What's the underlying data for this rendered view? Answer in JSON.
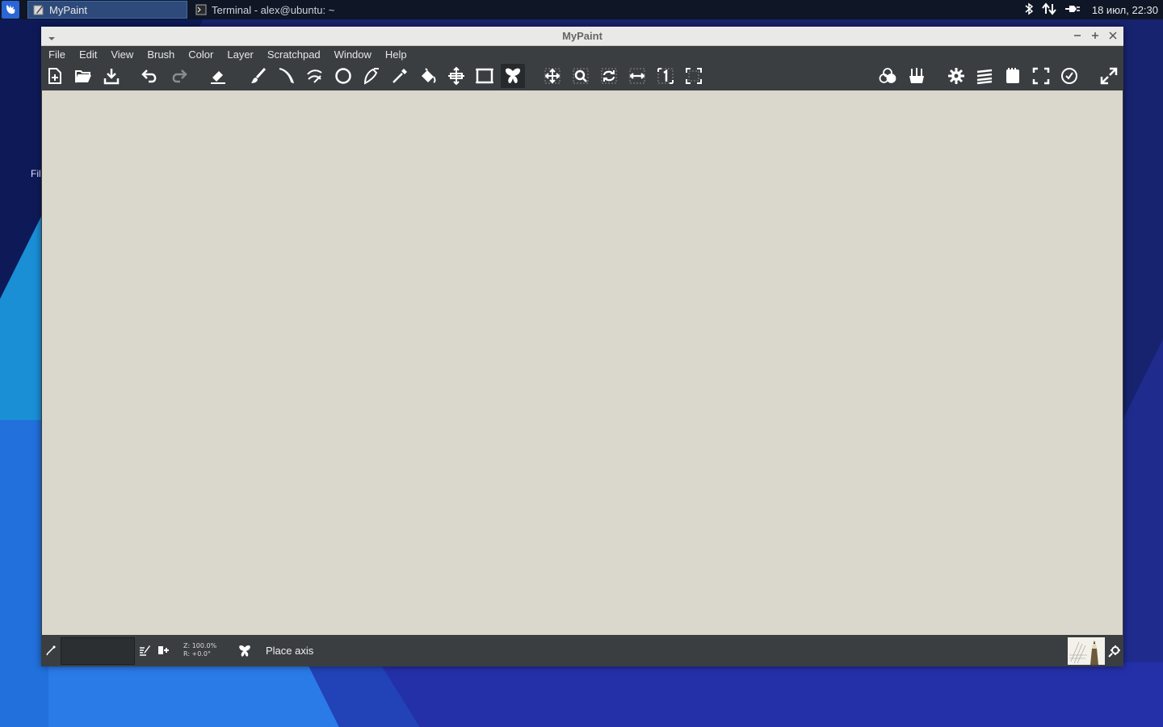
{
  "panel": {
    "tasks": [
      {
        "label": "MyPaint",
        "icon": "mypaint-app-icon",
        "active": true
      },
      {
        "label": "Terminal - alex@ubuntu: ~",
        "icon": "terminal-icon",
        "active": false
      }
    ],
    "tray": {
      "icons": [
        "bluetooth-icon",
        "network-icon",
        "power-icon"
      ],
      "clock": "18 июл, 22:30"
    }
  },
  "desktop": {
    "partial_label": "Fil"
  },
  "window": {
    "title": "MyPaint",
    "controls": [
      "minimize-icon",
      "maximize-icon",
      "close-icon"
    ]
  },
  "menubar": {
    "items": [
      "File",
      "Edit",
      "View",
      "Brush",
      "Color",
      "Layer",
      "Scratchpad",
      "Window",
      "Help"
    ]
  },
  "toolbar": {
    "groups": [
      [
        "new-document-icon",
        "open-file-icon",
        "save-icon"
      ],
      [
        "undo-icon",
        "redo-icon"
      ],
      [
        "eraser-icon",
        "freehand-brush-icon",
        "inking-icon",
        "connected-lines-icon",
        "ellipse-icon",
        "pen-curve-icon",
        "color-picker-icon",
        "fill-bucket-icon",
        "move-layer-icon",
        "frame-icon",
        "symmetry-icon"
      ],
      [
        "pan-view-icon",
        "zoom-view-icon",
        "rotate-view-icon",
        "mirror-view-icon",
        "reset-view-icon",
        "fit-view-icon"
      ],
      [
        "color-wheel-icon",
        "brushes-icon"
      ],
      [
        "settings-icon",
        "layers-icon",
        "scratchpad-icon",
        "fullscreen-icon",
        "history-icon"
      ],
      [
        "expand-icon"
      ]
    ],
    "active_tool": "symmetry-icon"
  },
  "colors": {
    "window_bg": "#3a3e40",
    "canvas": "#dad8cc",
    "titlebar": "#e9e9e7",
    "panel": "#0f1626",
    "desktop_blue": "#1e2a8a"
  },
  "statusbar": {
    "zoom": "Z: 100.0%",
    "rotation": "R: +0.0°",
    "status": "Place axis",
    "icons": [
      "picker-icon",
      "edit-brush-icon",
      "add-brush-icon",
      "symmetry-mode-icon",
      "brush-preview",
      "brush-settings-icon"
    ]
  }
}
